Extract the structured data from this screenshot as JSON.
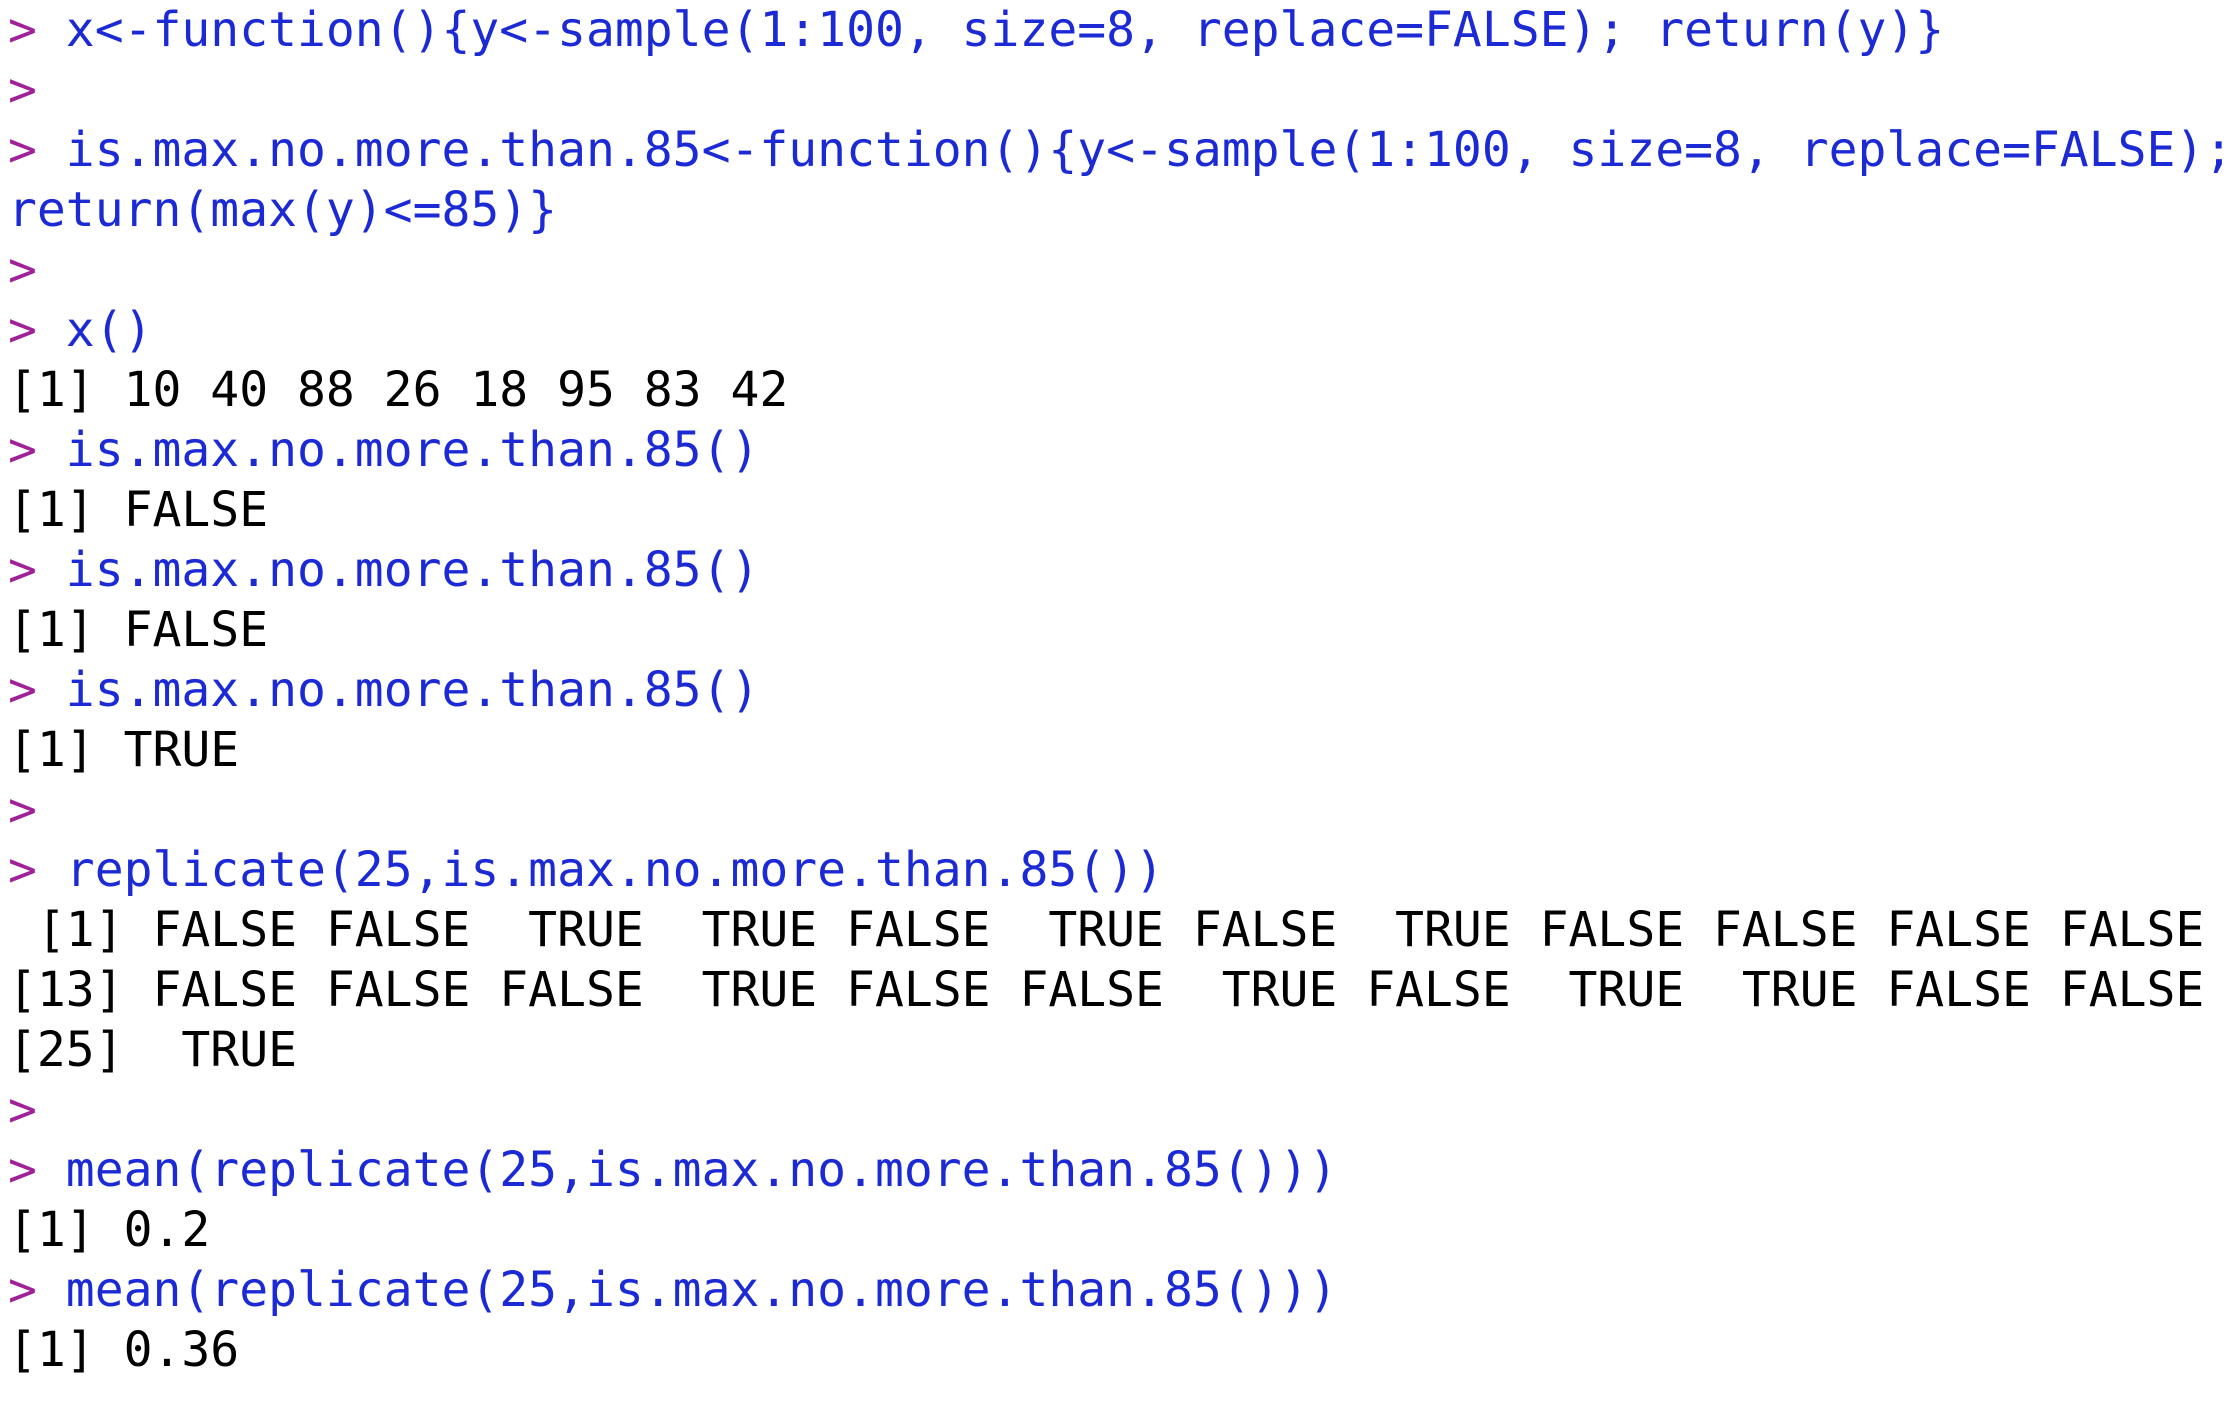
{
  "console": {
    "prompt_symbol": ">",
    "lines": [
      {
        "kind": "input",
        "text": " x<-function(){y<-sample(1:100, size=8, replace=FALSE); return(y)}"
      },
      {
        "kind": "input",
        "text": ""
      },
      {
        "kind": "input",
        "text": " is.max.no.more.than.85<-function(){y<-sample(1:100, size=8, replace=FALSE);"
      },
      {
        "kind": "continuation",
        "text": "return(max(y)<=85)}"
      },
      {
        "kind": "input",
        "text": ""
      },
      {
        "kind": "input",
        "text": " x()"
      },
      {
        "kind": "output",
        "text": "[1] 10 40 88 26 18 95 83 42"
      },
      {
        "kind": "input",
        "text": " is.max.no.more.than.85()"
      },
      {
        "kind": "output",
        "text": "[1] FALSE"
      },
      {
        "kind": "input",
        "text": " is.max.no.more.than.85()"
      },
      {
        "kind": "output",
        "text": "[1] FALSE"
      },
      {
        "kind": "input",
        "text": " is.max.no.more.than.85()"
      },
      {
        "kind": "output",
        "text": "[1] TRUE"
      },
      {
        "kind": "input",
        "text": ""
      },
      {
        "kind": "input",
        "text": " replicate(25,is.max.no.more.than.85())"
      },
      {
        "kind": "output",
        "text": " [1] FALSE FALSE  TRUE  TRUE FALSE  TRUE FALSE  TRUE FALSE FALSE FALSE FALSE"
      },
      {
        "kind": "output",
        "text": "[13] FALSE FALSE FALSE  TRUE FALSE FALSE  TRUE FALSE  TRUE  TRUE FALSE FALSE"
      },
      {
        "kind": "output",
        "text": "[25]  TRUE"
      },
      {
        "kind": "input",
        "text": ""
      },
      {
        "kind": "input",
        "text": " mean(replicate(25,is.max.no.more.than.85()))"
      },
      {
        "kind": "output",
        "text": "[1] 0.2"
      },
      {
        "kind": "input",
        "text": " mean(replicate(25,is.max.no.more.than.85()))"
      },
      {
        "kind": "output",
        "text": "[1] 0.36"
      }
    ]
  },
  "colors": {
    "prompt": "#a0229a",
    "command": "#1c2ad6",
    "output": "#000000",
    "background": "#ffffff"
  }
}
